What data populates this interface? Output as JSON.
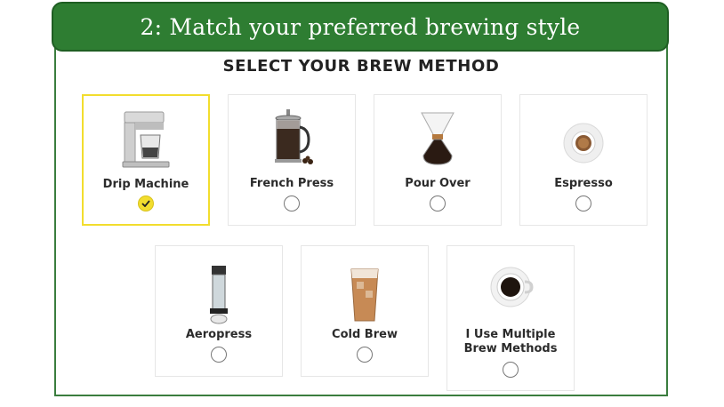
{
  "banner": {
    "title": "2: Match your preferred brewing style"
  },
  "section": {
    "heading": "SELECT YOUR BREW METHOD"
  },
  "options": [
    {
      "label": "Drip Machine",
      "selected": true,
      "icon": "drip-machine-icon"
    },
    {
      "label": "French Press",
      "selected": false,
      "icon": "french-press-icon"
    },
    {
      "label": "Pour Over",
      "selected": false,
      "icon": "pour-over-icon"
    },
    {
      "label": "Espresso",
      "selected": false,
      "icon": "espresso-cup-icon"
    },
    {
      "label": "Aeropress",
      "selected": false,
      "icon": "aeropress-icon"
    },
    {
      "label": "Cold Brew",
      "selected": false,
      "icon": "cold-brew-glass-icon"
    },
    {
      "label": "I Use Multiple\nBrew Methods",
      "selected": false,
      "icon": "coffee-cup-icon"
    }
  ],
  "colors": {
    "banner": "#2e7d32",
    "selected": "#f2dd2e"
  }
}
